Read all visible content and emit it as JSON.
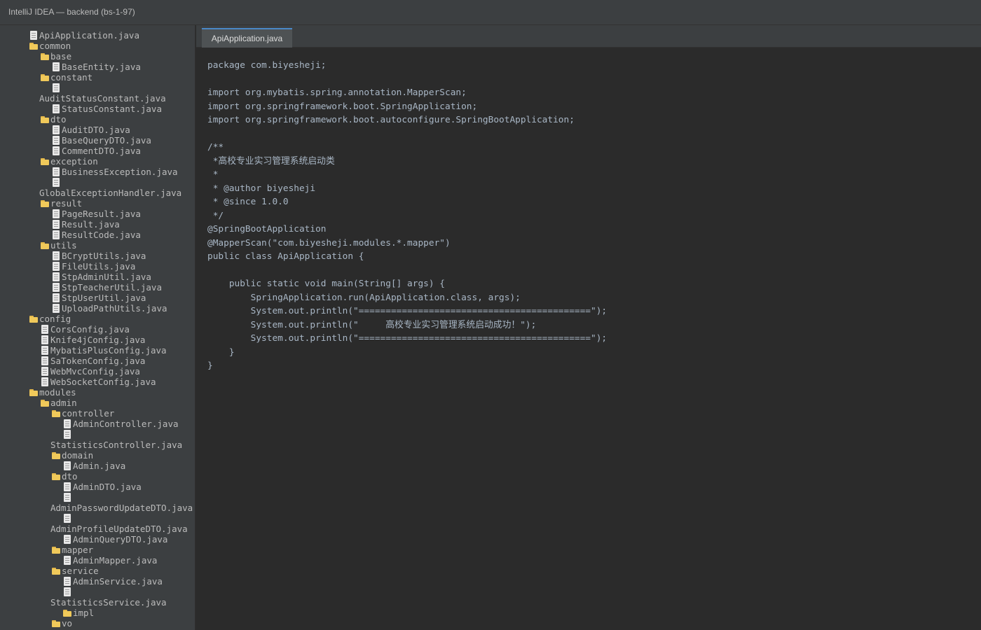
{
  "window": {
    "title": "IntelliJ IDEA — backend (bs-1-97)"
  },
  "tree": [
    {
      "depth": 0,
      "type": "file",
      "name": "ApiApplication.java"
    },
    {
      "depth": 0,
      "type": "folder",
      "name": "common"
    },
    {
      "depth": 1,
      "type": "folder",
      "name": "base"
    },
    {
      "depth": 2,
      "type": "file",
      "name": "BaseEntity.java"
    },
    {
      "depth": 1,
      "type": "folder",
      "name": "constant"
    },
    {
      "depth": 2,
      "type": "file",
      "name": "AuditStatusConstant.java",
      "wrap": true
    },
    {
      "depth": 2,
      "type": "file",
      "name": "StatusConstant.java"
    },
    {
      "depth": 1,
      "type": "folder",
      "name": "dto"
    },
    {
      "depth": 2,
      "type": "file",
      "name": "AuditDTO.java"
    },
    {
      "depth": 2,
      "type": "file",
      "name": "BaseQueryDTO.java"
    },
    {
      "depth": 2,
      "type": "file",
      "name": "CommentDTO.java"
    },
    {
      "depth": 1,
      "type": "folder",
      "name": "exception"
    },
    {
      "depth": 2,
      "type": "file",
      "name": "BusinessException.java"
    },
    {
      "depth": 2,
      "type": "file",
      "name": "GlobalExceptionHandler.java",
      "wrap": true
    },
    {
      "depth": 1,
      "type": "folder",
      "name": "result"
    },
    {
      "depth": 2,
      "type": "file",
      "name": "PageResult.java"
    },
    {
      "depth": 2,
      "type": "file",
      "name": "Result.java"
    },
    {
      "depth": 2,
      "type": "file",
      "name": "ResultCode.java"
    },
    {
      "depth": 1,
      "type": "folder",
      "name": "utils"
    },
    {
      "depth": 2,
      "type": "file",
      "name": "BCryptUtils.java"
    },
    {
      "depth": 2,
      "type": "file",
      "name": "FileUtils.java"
    },
    {
      "depth": 2,
      "type": "file",
      "name": "StpAdminUtil.java"
    },
    {
      "depth": 2,
      "type": "file",
      "name": "StpTeacherUtil.java"
    },
    {
      "depth": 2,
      "type": "file",
      "name": "StpUserUtil.java"
    },
    {
      "depth": 2,
      "type": "file",
      "name": "UploadPathUtils.java"
    },
    {
      "depth": 0,
      "type": "folder",
      "name": "config"
    },
    {
      "depth": 1,
      "type": "file",
      "name": "CorsConfig.java"
    },
    {
      "depth": 1,
      "type": "file",
      "name": "Knife4jConfig.java"
    },
    {
      "depth": 1,
      "type": "file",
      "name": "MybatisPlusConfig.java"
    },
    {
      "depth": 1,
      "type": "file",
      "name": "SaTokenConfig.java"
    },
    {
      "depth": 1,
      "type": "file",
      "name": "WebMvcConfig.java"
    },
    {
      "depth": 1,
      "type": "file",
      "name": "WebSocketConfig.java"
    },
    {
      "depth": 0,
      "type": "folder",
      "name": "modules"
    },
    {
      "depth": 1,
      "type": "folder",
      "name": "admin"
    },
    {
      "depth": 2,
      "type": "folder",
      "name": "controller"
    },
    {
      "depth": 3,
      "type": "file",
      "name": "AdminController.java"
    },
    {
      "depth": 3,
      "type": "file",
      "name": "StatisticsController.java",
      "wrap": true
    },
    {
      "depth": 2,
      "type": "folder",
      "name": "domain"
    },
    {
      "depth": 3,
      "type": "file",
      "name": "Admin.java"
    },
    {
      "depth": 2,
      "type": "folder",
      "name": "dto"
    },
    {
      "depth": 3,
      "type": "file",
      "name": "AdminDTO.java"
    },
    {
      "depth": 3,
      "type": "file",
      "name": "AdminPasswordUpdateDTO.java",
      "wrap": true
    },
    {
      "depth": 3,
      "type": "file",
      "name": "AdminProfileUpdateDTO.java",
      "wrap": true
    },
    {
      "depth": 3,
      "type": "file",
      "name": "AdminQueryDTO.java"
    },
    {
      "depth": 2,
      "type": "folder",
      "name": "mapper"
    },
    {
      "depth": 3,
      "type": "file",
      "name": "AdminMapper.java"
    },
    {
      "depth": 2,
      "type": "folder",
      "name": "service"
    },
    {
      "depth": 3,
      "type": "file",
      "name": "AdminService.java"
    },
    {
      "depth": 3,
      "type": "file",
      "name": "StatisticsService.java",
      "wrap": true
    },
    {
      "depth": 3,
      "type": "folder",
      "name": "impl"
    },
    {
      "depth": 2,
      "type": "folder",
      "name": "vo"
    }
  ],
  "editor": {
    "active_tab": "ApiApplication.java",
    "lines": [
      "package com.biyesheji;",
      "",
      "import org.mybatis.spring.annotation.MapperScan;",
      "import org.springframework.boot.SpringApplication;",
      "import org.springframework.boot.autoconfigure.SpringBootApplication;",
      "",
      "/**",
      " *高校专业实习管理系统启动类",
      " *",
      " * @author biyesheji",
      " * @since 1.0.0",
      " */",
      "@SpringBootApplication",
      "@MapperScan(\"com.biyesheji.modules.*.mapper\")",
      "public class ApiApplication {",
      "",
      "    public static void main(String[] args) {",
      "        SpringApplication.run(ApiApplication.class, args);",
      "        System.out.println(\"===========================================\");",
      "        System.out.println(\"     高校专业实习管理系统启动成功！\");",
      "        System.out.println(\"===========================================\");",
      "    }",
      "}"
    ]
  },
  "colors": {
    "editor_bg": "#2b2b2b",
    "panel_bg": "#3c3f41",
    "text": "#a9b7c6",
    "tab_accent": "#4a88c7",
    "folder": "#f0c95a"
  }
}
